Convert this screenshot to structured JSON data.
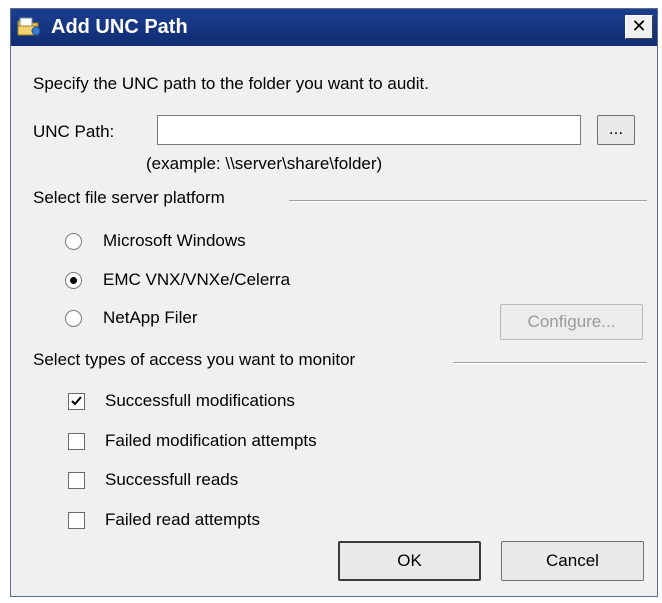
{
  "title": "Add UNC Path",
  "instruction": "Specify the UNC path to the folder you want to audit.",
  "unc": {
    "label": "UNC Path:",
    "value": "",
    "browse_label": "...",
    "example": "(example: \\\\server\\share\\folder)"
  },
  "platform": {
    "heading": "Select file server platform",
    "options": [
      {
        "label": "Microsoft Windows",
        "selected": false
      },
      {
        "label": "EMC VNX/VNXe/Celerra",
        "selected": true
      },
      {
        "label": "NetApp Filer",
        "selected": false
      }
    ],
    "configure_label": "Configure..."
  },
  "access": {
    "heading": "Select types of access you want to monitor",
    "items": [
      {
        "label": "Successfull modifications",
        "checked": true
      },
      {
        "label": "Failed modification attempts",
        "checked": false
      },
      {
        "label": "Successfull reads",
        "checked": false
      },
      {
        "label": "Failed read attempts",
        "checked": false
      }
    ]
  },
  "buttons": {
    "ok": "OK",
    "cancel": "Cancel"
  },
  "icons": {
    "title": "folder-icon",
    "close": "close-icon"
  }
}
